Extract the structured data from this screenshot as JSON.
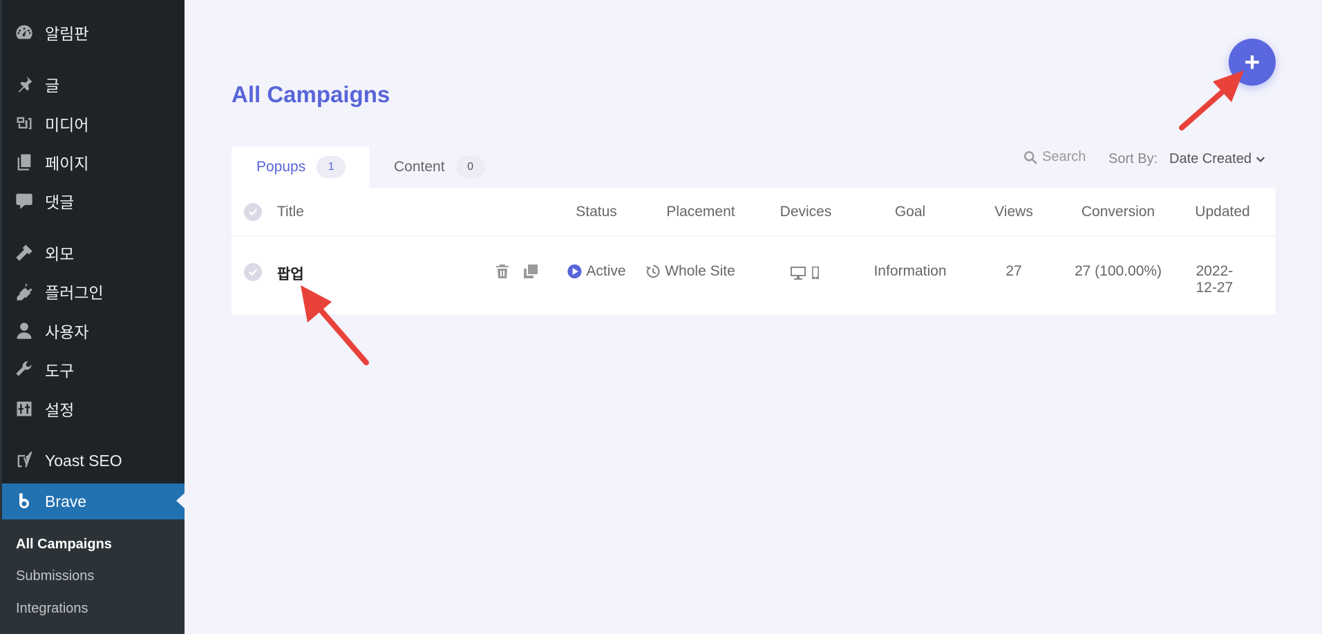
{
  "sidebar": {
    "items": [
      {
        "label": "알림판",
        "icon": "dashboard-icon"
      },
      {
        "label": "글",
        "icon": "pin-icon"
      },
      {
        "label": "미디어",
        "icon": "media-icon"
      },
      {
        "label": "페이지",
        "icon": "pages-icon"
      },
      {
        "label": "댓글",
        "icon": "comments-icon"
      },
      {
        "label": "외모",
        "icon": "appearance-icon"
      },
      {
        "label": "플러그인",
        "icon": "plugins-icon"
      },
      {
        "label": "사용자",
        "icon": "users-icon"
      },
      {
        "label": "도구",
        "icon": "tools-icon"
      },
      {
        "label": "설정",
        "icon": "settings-icon"
      },
      {
        "label": "Yoast SEO",
        "icon": "yoast-icon"
      },
      {
        "label": "Brave",
        "icon": "brave-icon"
      }
    ],
    "submenu": [
      "All Campaigns",
      "Submissions",
      "Integrations"
    ]
  },
  "main": {
    "title": "All Campaigns",
    "add_button_icon": "plus-icon",
    "tabs": [
      {
        "label": "Popups",
        "count": "1"
      },
      {
        "label": "Content",
        "count": "0"
      }
    ],
    "search_label": "Search",
    "sort_label": "Sort By:",
    "sort_value": "Date Created"
  },
  "table": {
    "columns": [
      "Title",
      "Status",
      "Placement",
      "Devices",
      "Goal",
      "Views",
      "Conversion",
      "Updated"
    ],
    "rows": [
      {
        "title": "팝업",
        "status": "Active",
        "placement": "Whole Site",
        "devices": [
          "desktop-icon",
          "mobile-icon"
        ],
        "goal": "Information",
        "views": "27",
        "conversion": "27 (100.00%)",
        "updated": "2022-12-27"
      }
    ]
  },
  "colors": {
    "accent": "#5865d8",
    "sidebar_bg": "#1d2327",
    "active_menu": "#2271b1",
    "annotation_arrow": "#e8423a"
  }
}
